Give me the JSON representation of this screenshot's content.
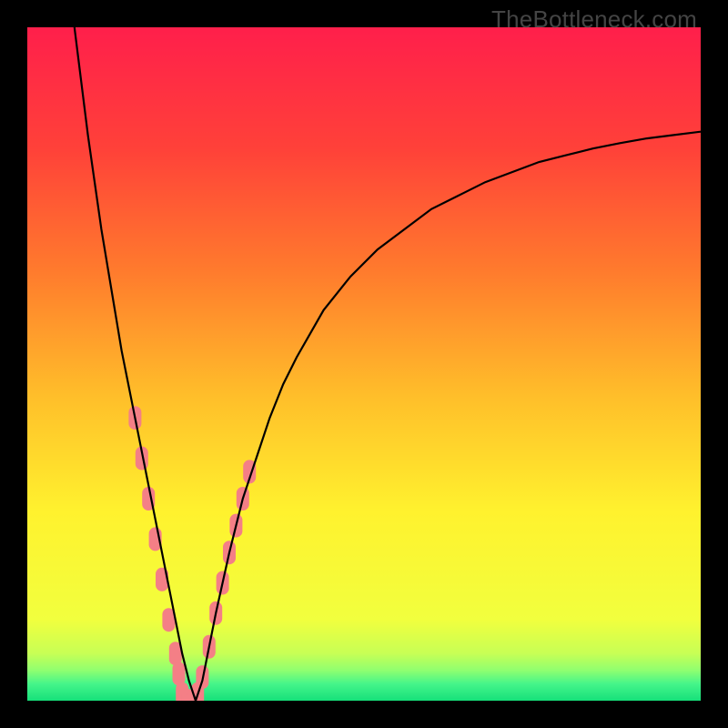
{
  "watermark": "TheBottleneck.com",
  "chart_data": {
    "type": "line",
    "title": "",
    "xlabel": "",
    "ylabel": "",
    "xlim": [
      0,
      100
    ],
    "ylim": [
      0,
      100
    ],
    "grid": false,
    "legend": false,
    "gradient_stops": [
      {
        "pos": 0.0,
        "color": "#ff1f4b"
      },
      {
        "pos": 0.18,
        "color": "#ff4139"
      },
      {
        "pos": 0.36,
        "color": "#ff7a2d"
      },
      {
        "pos": 0.55,
        "color": "#ffbf2a"
      },
      {
        "pos": 0.72,
        "color": "#fff22e"
      },
      {
        "pos": 0.88,
        "color": "#f1ff3e"
      },
      {
        "pos": 0.93,
        "color": "#c7ff55"
      },
      {
        "pos": 0.955,
        "color": "#8fff70"
      },
      {
        "pos": 0.975,
        "color": "#45f58a"
      },
      {
        "pos": 1.0,
        "color": "#16e07a"
      }
    ],
    "series": [
      {
        "name": "bottleneck-curve",
        "color": "#000000",
        "x": [
          7,
          8,
          9,
          10,
          11,
          12,
          13,
          14,
          15,
          16,
          17,
          18,
          19,
          20,
          21,
          22,
          23,
          24,
          25,
          26,
          27,
          28,
          30,
          32,
          34,
          36,
          38,
          40,
          44,
          48,
          52,
          56,
          60,
          64,
          68,
          72,
          76,
          80,
          84,
          88,
          92,
          96,
          100
        ],
        "values": [
          100,
          92,
          84,
          77,
          70,
          64,
          58,
          52,
          47,
          42,
          37,
          32,
          27,
          22,
          17,
          12,
          7,
          3,
          0,
          3,
          8,
          13,
          22,
          30,
          36,
          42,
          47,
          51,
          58,
          63,
          67,
          70,
          73,
          75,
          77,
          78.5,
          80,
          81,
          82,
          82.8,
          83.5,
          84,
          84.5
        ]
      }
    ],
    "markers": {
      "name": "highlighted-points",
      "color": "#f47f86",
      "style": "rounded-rect",
      "x": [
        16,
        17,
        18,
        19,
        20,
        21,
        22,
        22.5,
        23,
        23.8,
        24.6,
        25.3,
        26,
        27,
        28,
        29,
        30,
        31,
        32,
        33
      ],
      "values": [
        42,
        36,
        30,
        24,
        18,
        12,
        7,
        4,
        1,
        0,
        0,
        1,
        3.5,
        8,
        13,
        17.5,
        22,
        26,
        30,
        34
      ]
    }
  }
}
